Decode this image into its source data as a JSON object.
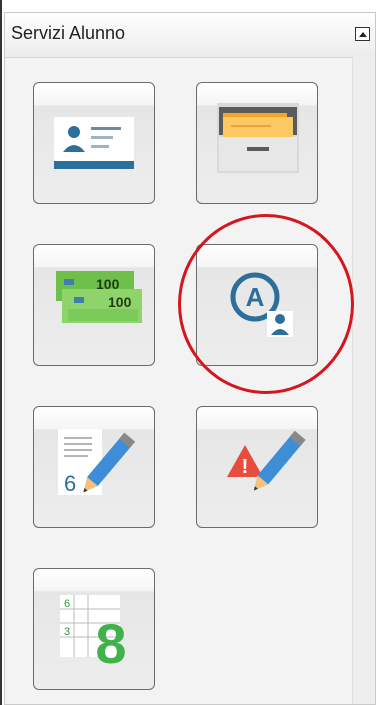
{
  "panel": {
    "title": "Servizi Alunno",
    "collapse_icon": "triangle-up-icon"
  },
  "tiles": [
    {
      "id": "student-card",
      "icon": "id-card-icon"
    },
    {
      "id": "archive",
      "icon": "filing-cabinet-icon"
    },
    {
      "id": "payments",
      "icon": "banknotes-icon",
      "note_amount_1": "100",
      "note_amount_2": "100"
    },
    {
      "id": "absences",
      "icon": "absence-user-icon",
      "letter": "A"
    },
    {
      "id": "grades",
      "icon": "grade-pencil-icon",
      "grade": "6"
    },
    {
      "id": "disciplinary-notes",
      "icon": "warning-pencil-icon",
      "mark": "!"
    },
    {
      "id": "report-card",
      "icon": "grade-grid-icon",
      "small_1": "6",
      "small_2": "3",
      "big": "8"
    }
  ],
  "colors": {
    "accent_blue": "#2d6f9b",
    "highlight_red": "#d4161e",
    "warning_red": "#e74c3c",
    "money_green": "#4caf50",
    "folder_orange": "#f5a623"
  }
}
